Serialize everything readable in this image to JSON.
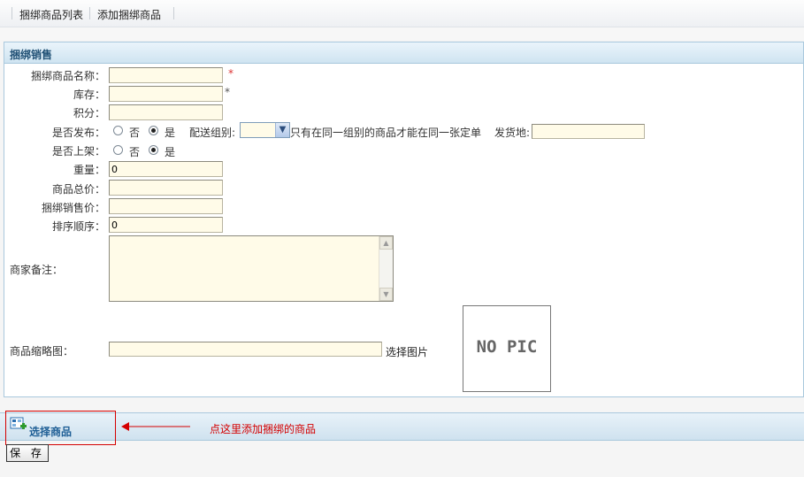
{
  "tabs": [
    "捆绑商品列表",
    "添加捆绑商品"
  ],
  "panel": {
    "title": "捆绑销售"
  },
  "form": {
    "name_label": "捆绑商品名称：",
    "name_value": "",
    "name_required": "*",
    "stock_label": "库存：",
    "stock_value": "",
    "stock_required": "*",
    "points_label": "积分：",
    "points_value": "",
    "publish_label": "是否发布：",
    "publish_no": "否",
    "publish_yes": "是",
    "publish_selected": "是",
    "delivery_group_label": "配送组别:",
    "delivery_group_value": "",
    "delivery_group_note": "只有在同一组别的商品才能在同一张定单",
    "ship_from_label": "发货地:",
    "ship_from_value": "",
    "onshelf_label": "是否上架：",
    "onshelf_no": "否",
    "onshelf_yes": "是",
    "onshelf_selected": "是",
    "weight_label": "重量：",
    "weight_value": "0",
    "total_price_label": "商品总价：",
    "total_price_value": "",
    "bundle_price_label": "捆绑销售价：",
    "bundle_price_value": "",
    "sort_label": "排序顺序：",
    "sort_value": "0",
    "remark_label": "商家备注：",
    "remark_value": "",
    "thumb_label": "商品缩略图：",
    "thumb_value": "",
    "choose_image": "选择图片",
    "no_pic": "NO PIC"
  },
  "bottom": {
    "select_goods": "选择商品",
    "hint": "点这里添加捆绑的商品",
    "save": "保 存"
  },
  "colors": {
    "hint_red": "#d40000",
    "input_bg": "#fffbe8",
    "header_blue": "#cfe4f1"
  }
}
